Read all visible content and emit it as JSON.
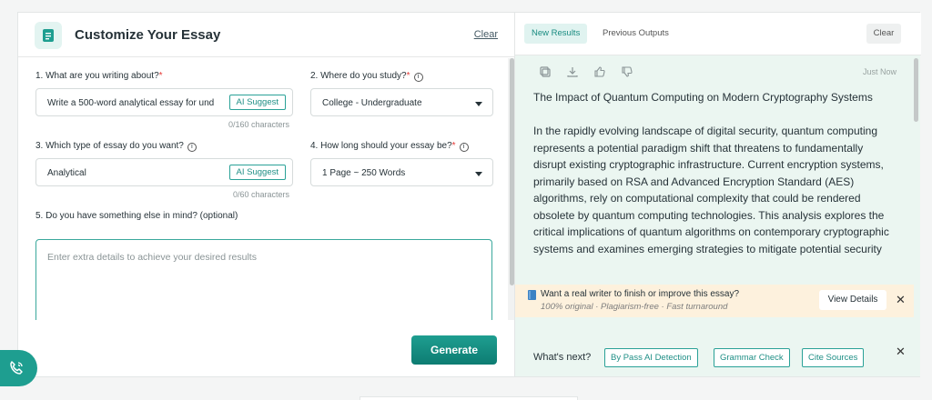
{
  "header": {
    "title": "Customize Your Essay",
    "clear_label": "Clear"
  },
  "form": {
    "q1": {
      "label": "1. What are you writing about?",
      "required": "*",
      "value": "Write a 500-word analytical essay for und",
      "ai_label": "AI Suggest",
      "counter": "0/160 characters"
    },
    "q2": {
      "label": "2. Where do you study?",
      "required": "*",
      "value": "College - Undergraduate"
    },
    "q3": {
      "label": "3. Which type of essay do you want?",
      "value": "Analytical",
      "ai_label": "AI Suggest",
      "counter": "0/60 characters"
    },
    "q4": {
      "label": "4. How long should your essay be?",
      "required": "*",
      "value": "1 Page ~ 250 Words"
    },
    "q5": {
      "label": "5. Do you have something else in mind? (optional)",
      "placeholder": "Enter extra details to achieve your desired results"
    },
    "info_glyph": "i",
    "generate_label": "Generate"
  },
  "results": {
    "tabs": [
      "New Results",
      "Previous Outputs"
    ],
    "clear_label": "Clear",
    "timestamp": "Just Now",
    "essay_title": "The Impact of Quantum Computing on Modern Cryptography Systems",
    "essay_body": "In the rapidly evolving landscape of digital security, quantum computing represents a potential paradigm shift that threatens to fundamentally disrupt existing cryptographic infrastructure. Current encryption systems, primarily based on RSA and Advanced Encryption Standard (AES) algorithms, rely on computational complexity that could be rendered obsolete by quantum computing technologies. This analysis explores the critical implications of quantum algorithms on contemporary cryptographic systems and examines emerging strategies to mitigate potential security",
    "action_icons": [
      "copy-icon",
      "download-icon",
      "thumbs-up-icon",
      "thumbs-down-icon"
    ]
  },
  "promo": {
    "headline": "Want a real writer to finish or improve this essay?",
    "subline": "100% original · Plagiarism-free · Fast turnaround",
    "button": "View Details",
    "close": "✕"
  },
  "next": {
    "label": "What's next?",
    "chips": [
      "By Pass AI Detection",
      "Grammar Check",
      "Cite Sources"
    ],
    "close": "✕"
  },
  "colors": {
    "accent": "#1e9e90",
    "results_bg": "#ebf6f1",
    "promo_bg": "#fdf1dd",
    "required": "#e53935"
  }
}
